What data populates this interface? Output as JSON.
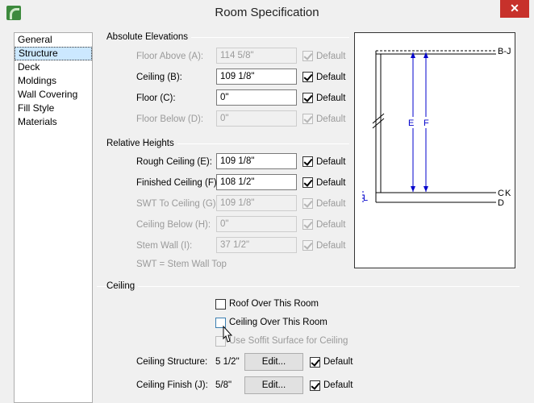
{
  "window": {
    "title": "Room Specification",
    "close_glyph": "✕",
    "app_icon": "app-logo-icon"
  },
  "nav": {
    "items": [
      "General",
      "Structure",
      "Deck",
      "Moldings",
      "Wall Covering",
      "Fill Style",
      "Materials"
    ],
    "selected": 1
  },
  "absolute_elevations": {
    "header": "Absolute Elevations",
    "floor_above": {
      "label": "Floor Above (A):",
      "value": "114 5/8\"",
      "default_label": "Default",
      "default": true,
      "enabled": false
    },
    "ceiling": {
      "label": "Ceiling (B):",
      "value": "109 1/8\"",
      "default_label": "Default",
      "default": true,
      "enabled": true
    },
    "floor": {
      "label": "Floor (C):",
      "value": "0\"",
      "default_label": "Default",
      "default": true,
      "enabled": true
    },
    "floor_below": {
      "label": "Floor Below (D):",
      "value": "0\"",
      "default_label": "Default",
      "default": true,
      "enabled": false
    }
  },
  "relative_heights": {
    "header": "Relative Heights",
    "rough_ceiling": {
      "label": "Rough Ceiling (E):",
      "value": "109 1/8\"",
      "default_label": "Default",
      "default": true,
      "enabled": true
    },
    "finished_ceiling": {
      "label": "Finished Ceiling (F):",
      "value": "108 1/2\"",
      "default_label": "Default",
      "default": true,
      "enabled": true
    },
    "swt_to_ceiling": {
      "label": "SWT To Ceiling (G):",
      "value": "109 1/8\"",
      "default_label": "Default",
      "default": true,
      "enabled": false
    },
    "ceiling_below": {
      "label": "Ceiling Below (H):",
      "value": "0\"",
      "default_label": "Default",
      "default": true,
      "enabled": false
    },
    "stem_wall": {
      "label": "Stem Wall (I):",
      "value": "37 1/2\"",
      "default_label": "Default",
      "default": true,
      "enabled": false
    },
    "note": "SWT = Stem Wall Top"
  },
  "ceiling": {
    "header": "Ceiling",
    "roof_over": {
      "label": "Roof Over This Room",
      "checked": false
    },
    "ceiling_over": {
      "label": "Ceiling Over This Room",
      "checked": false
    },
    "soffit": {
      "label": "Use Soffit Surface for Ceiling",
      "checked": false,
      "enabled": false
    },
    "structure": {
      "label": "Ceiling Structure:",
      "value": "5 1/2\"",
      "button": "Edit...",
      "default_label": "Default",
      "default": true
    },
    "finish": {
      "label": "Ceiling Finish (J):",
      "value": "5/8\"",
      "button": "Edit...",
      "default_label": "Default",
      "default": true
    }
  },
  "diagram": {
    "labels": {
      "b_j": "B-J",
      "e": "E",
      "f": "F",
      "c": "C",
      "k": "K",
      "d": "D",
      "l": "L"
    },
    "colors": {
      "dimension": "#0000cc",
      "line": "#000000"
    }
  }
}
